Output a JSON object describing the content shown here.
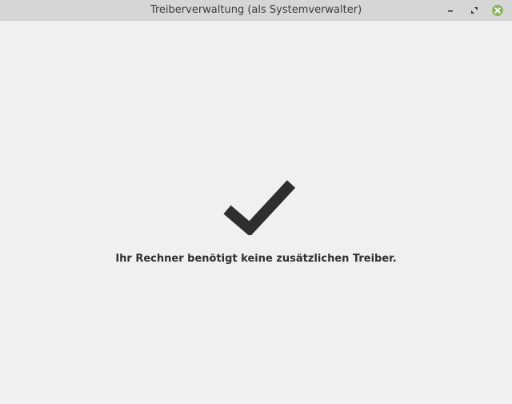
{
  "window": {
    "title": "Treiberverwaltung (als Systemverwalter)",
    "controls": {
      "minimize_icon": "minimize-icon",
      "maximize_icon": "maximize-icon",
      "close_icon": "close-icon",
      "close_color": "#8ab563"
    }
  },
  "main": {
    "status_icon": "checkmark-icon",
    "message": "Ihr Rechner benötigt keine zusätzlichen Treiber."
  },
  "colors": {
    "titlebar": "#d6d6d6",
    "background": "#f0f0f0",
    "checkmark": "#2e2e2e",
    "text": "#303030"
  }
}
